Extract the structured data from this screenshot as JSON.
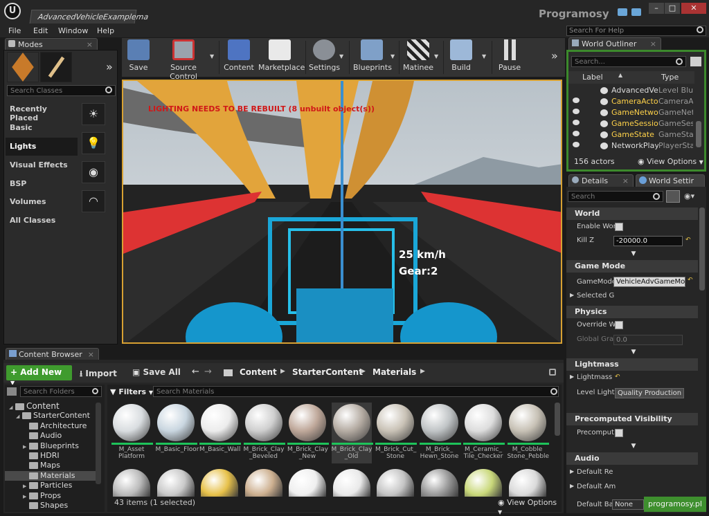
{
  "window": {
    "doc_tab": "AdvancedVehicleExamplema",
    "brand": "Programosy",
    "min": "–",
    "max": "□",
    "close": "✕"
  },
  "menu": [
    "File",
    "Edit",
    "Window",
    "Help"
  ],
  "help_search_placeholder": "Search For Help",
  "modes": {
    "tab": "Modes",
    "search_placeholder": "Search Classes",
    "categories": [
      "Recently Placed",
      "Basic",
      "Lights",
      "Visual Effects",
      "BSP",
      "Volumes",
      "All Classes"
    ],
    "active": "Lights"
  },
  "toolbar": {
    "buttons": [
      "Save",
      "Source Control",
      "Content",
      "Marketplace",
      "Settings",
      "Blueprints",
      "Matinee",
      "Build",
      "Pause"
    ],
    "overflow": "»"
  },
  "viewport": {
    "warning": "LIGHTING NEEDS TO BE REBUILT (8 unbuilt object(s))",
    "speed": "25 km/h",
    "gear": "Gear:2"
  },
  "content_browser": {
    "tab": "Content Browser",
    "add_new": "Add New",
    "import": "Import",
    "save_all": "Save All",
    "path": [
      "Content",
      "StarterContent",
      "Materials"
    ],
    "search_folders": "Search Folders",
    "filters": "Filters",
    "search_materials": "Search Materials",
    "tree": [
      {
        "label": "Content",
        "depth": 0
      },
      {
        "label": "StarterContent",
        "depth": 1
      },
      {
        "label": "Architecture",
        "depth": 2
      },
      {
        "label": "Audio",
        "depth": 2
      },
      {
        "label": "Blueprints",
        "depth": 2
      },
      {
        "label": "HDRI",
        "depth": 2
      },
      {
        "label": "Maps",
        "depth": 2
      },
      {
        "label": "Materials",
        "depth": 2
      },
      {
        "label": "Particles",
        "depth": 2
      },
      {
        "label": "Props",
        "depth": 2
      },
      {
        "label": "Shapes",
        "depth": 2
      }
    ],
    "assets": [
      {
        "name": "M_Asset Platform",
        "color": "#d9dde0"
      },
      {
        "name": "M_Basic_Floor",
        "color": "#c9d6e0"
      },
      {
        "name": "M_Basic_Wall",
        "color": "#ececec"
      },
      {
        "name": "M_Brick_Clay _Beveled",
        "color": "#cfcfcf"
      },
      {
        "name": "M_Brick_Clay _New",
        "color": "#bfa89a"
      },
      {
        "name": "M_Brick_Clay _Old",
        "color": "#b5aca3"
      },
      {
        "name": "M_Brick_Cut_ Stone",
        "color": "#c9c2b6"
      },
      {
        "name": "M_Brick_ Hewn_Stone",
        "color": "#c0c4c6"
      },
      {
        "name": "M_Ceramic_ Tile_Checker",
        "color": "#dddddd"
      },
      {
        "name": "M_Cobble Stone_Pebble",
        "color": "#c7c1b5"
      }
    ],
    "row2_colors": [
      "#bbbbbb",
      "#c9c9c9",
      "#e7c14a",
      "#cdb090",
      "#efefef",
      "#e9e9e9",
      "#c4c4c4",
      "#9a9a9a",
      "#c9d87a",
      "#dadada"
    ],
    "items_count": "43 items (1 selected)",
    "view_options": "View Options"
  },
  "outliner": {
    "tab": "World Outliner",
    "search_placeholder": "Search...",
    "col_label": "Label",
    "col_type": "Type",
    "rows": [
      {
        "label": "AdvancedVeh",
        "type": "Level Blue",
        "highlight": false
      },
      {
        "label": "CameraActor",
        "type": "CameraA",
        "highlight": true
      },
      {
        "label": "GameNetwork",
        "type": "GameNetv",
        "highlight": true
      },
      {
        "label": "GameSession",
        "type": "GameSes",
        "highlight": true
      },
      {
        "label": "GameState",
        "type": "GameStat",
        "highlight": true
      },
      {
        "label": "NetworkPlaye",
        "type": "PlayerSta",
        "highlight": false
      }
    ],
    "actors_count": "156 actors",
    "view_options": "View Options"
  },
  "details": {
    "tab_details": "Details",
    "tab_world": "World Settir",
    "search_placeholder": "Search",
    "sections": {
      "world": "World",
      "game_mode": "Game Mode",
      "physics": "Physics",
      "lightmass": "Lightmass",
      "precomputed": "Precomputed Visibility",
      "audio": "Audio"
    },
    "props": {
      "enable_world": "Enable Wor",
      "kill_z": "Kill Z",
      "kill_z_value": "-20000.0",
      "game_mode": "GameMode",
      "game_mode_value": "VehicleAdvGameMoc",
      "selected": "Selected G",
      "override": "Override W",
      "global_grav": "Global Grav",
      "global_grav_value": "0.0",
      "lightmass": "Lightmass",
      "level_light": "Level Light",
      "quality": "Quality Production",
      "precompute": "Precomput",
      "default_rev": "Default Re",
      "default_amb": "Default Am",
      "default_base": "Default Ba",
      "none": "None"
    },
    "watermark": "programosy.pl"
  },
  "colors": {
    "accent_green": "#3c8a2c",
    "add_new_green": "#3f9b2e",
    "viewport_border": "#d8a132",
    "highlight_text": "#ffd24a"
  }
}
